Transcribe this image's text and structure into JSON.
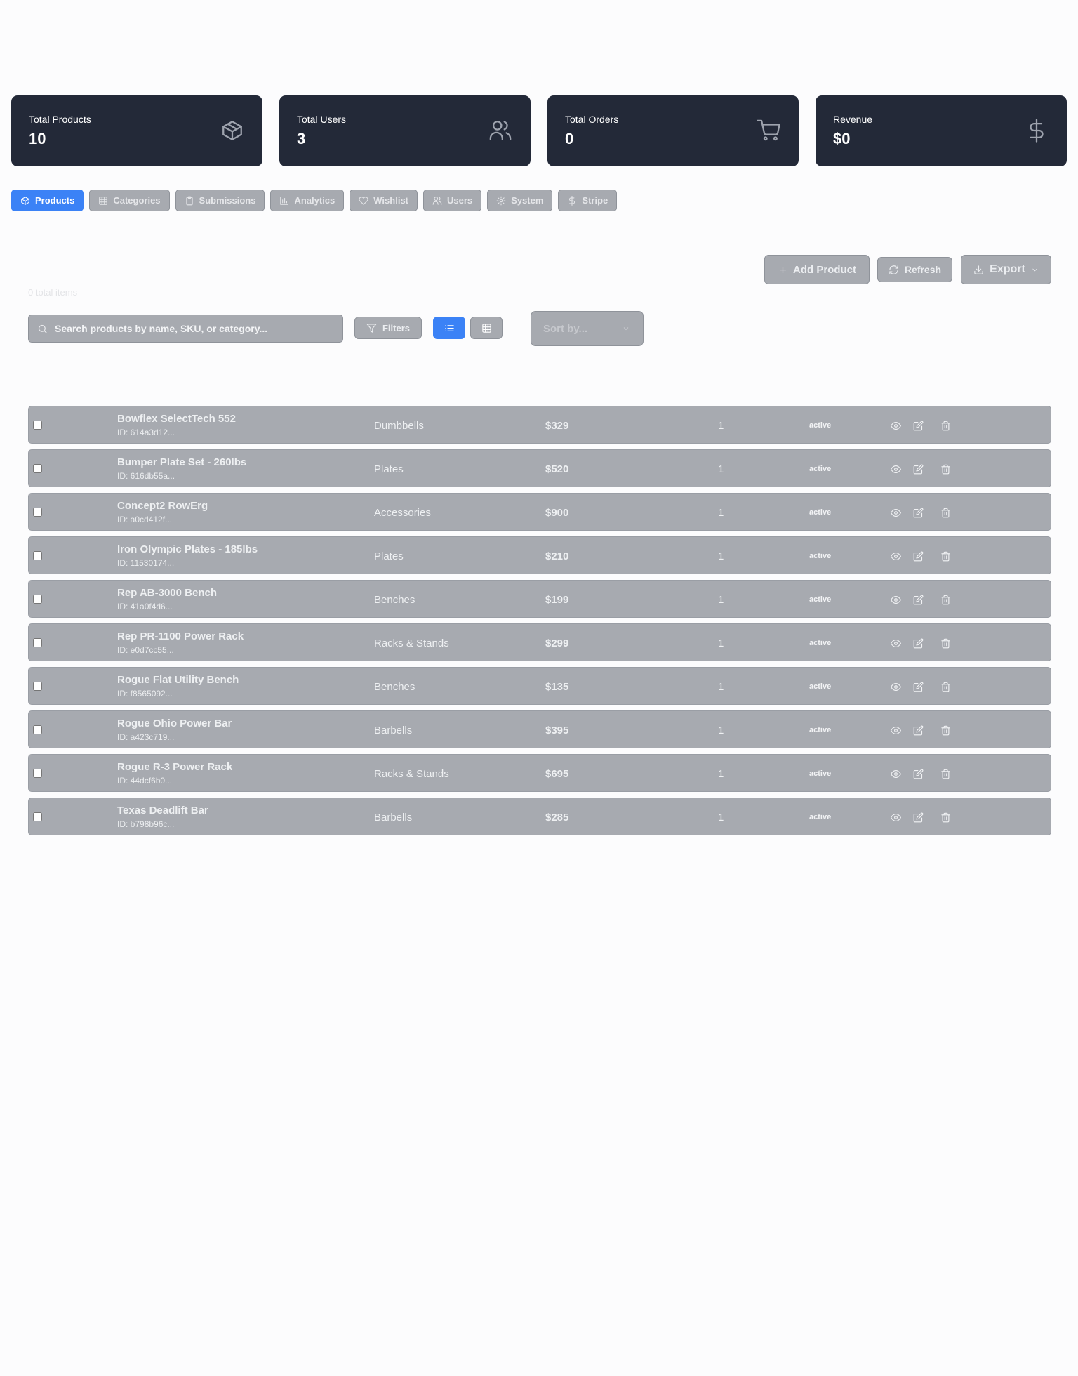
{
  "stats": [
    {
      "label": "Total Products",
      "value": "10",
      "icon": "box-icon"
    },
    {
      "label": "Total Users",
      "value": "3",
      "icon": "users-icon"
    },
    {
      "label": "Total Orders",
      "value": "0",
      "icon": "cart-icon"
    },
    {
      "label": "Revenue",
      "value": "$0",
      "icon": "dollar-icon"
    }
  ],
  "tabs": [
    {
      "label": "Products",
      "icon": "box-icon",
      "active": true
    },
    {
      "label": "Categories",
      "icon": "grid-icon"
    },
    {
      "label": "Submissions",
      "icon": "clipboard-icon"
    },
    {
      "label": "Analytics",
      "icon": "bar-chart-icon"
    },
    {
      "label": "Wishlist",
      "icon": "heart-icon"
    },
    {
      "label": "Users",
      "icon": "users-icon"
    },
    {
      "label": "System",
      "icon": "gear-icon"
    },
    {
      "label": "Stripe",
      "icon": "dollar-icon"
    }
  ],
  "toolbar": {
    "total_items": "0 total items",
    "add_label": "Add Product",
    "refresh_label": "Refresh",
    "export_label": "Export",
    "filters_label": "Filters",
    "search_placeholder": "Search products by name, SKU, or category...",
    "sort_placeholder": "Sort by..."
  },
  "products": [
    {
      "name": "Bowflex SelectTech 552",
      "id": "ID: 614a3d12...",
      "category": "Dumbbells",
      "price": "$329",
      "qty": "1",
      "status": "active"
    },
    {
      "name": "Bumper Plate Set - 260lbs",
      "id": "ID: 616db55a...",
      "category": "Plates",
      "price": "$520",
      "qty": "1",
      "status": "active"
    },
    {
      "name": "Concept2 RowErg",
      "id": "ID: a0cd412f...",
      "category": "Accessories",
      "price": "$900",
      "qty": "1",
      "status": "active"
    },
    {
      "name": "Iron Olympic Plates - 185lbs",
      "id": "ID: 11530174...",
      "category": "Plates",
      "price": "$210",
      "qty": "1",
      "status": "active"
    },
    {
      "name": "Rep AB-3000 Bench",
      "id": "ID: 41a0f4d6...",
      "category": "Benches",
      "price": "$199",
      "qty": "1",
      "status": "active"
    },
    {
      "name": "Rep PR-1100 Power Rack",
      "id": "ID: e0d7cc55...",
      "category": "Racks & Stands",
      "price": "$299",
      "qty": "1",
      "status": "active"
    },
    {
      "name": "Rogue Flat Utility Bench",
      "id": "ID: f8565092...",
      "category": "Benches",
      "price": "$135",
      "qty": "1",
      "status": "active"
    },
    {
      "name": "Rogue Ohio Power Bar",
      "id": "ID: a423c719...",
      "category": "Barbells",
      "price": "$395",
      "qty": "1",
      "status": "active"
    },
    {
      "name": "Rogue R-3 Power Rack",
      "id": "ID: 44dcf6b0...",
      "category": "Racks & Stands",
      "price": "$695",
      "qty": "1",
      "status": "active"
    },
    {
      "name": "Texas Deadlift Bar",
      "id": "ID: b798b96c...",
      "category": "Barbells",
      "price": "$285",
      "qty": "1",
      "status": "active"
    }
  ]
}
